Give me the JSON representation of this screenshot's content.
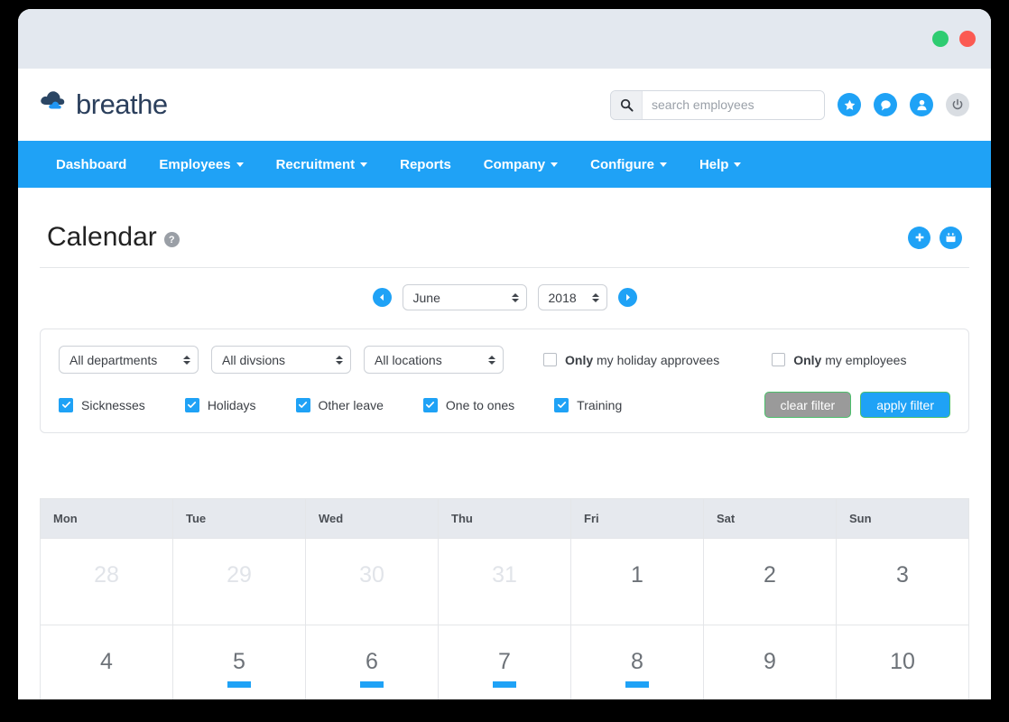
{
  "window": {
    "dots": [
      {
        "name": "minimize-dot",
        "color": "#2ecc71"
      },
      {
        "name": "close-dot",
        "color": "#fb5a52"
      }
    ]
  },
  "brand": {
    "name": "breathe",
    "logo_icon": "cloud-icon"
  },
  "search": {
    "placeholder": "search employees",
    "value": "",
    "icon": "search-icon"
  },
  "header_icons": [
    {
      "name": "star-icon",
      "glyph": "★"
    },
    {
      "name": "chat-icon",
      "glyph": "●"
    },
    {
      "name": "user-icon",
      "glyph": "●"
    },
    {
      "name": "power-icon",
      "glyph": "⏻"
    }
  ],
  "nav": {
    "items": [
      {
        "label": "Dashboard",
        "has_dropdown": false
      },
      {
        "label": "Employees",
        "has_dropdown": true
      },
      {
        "label": "Recruitment",
        "has_dropdown": true
      },
      {
        "label": "Reports",
        "has_dropdown": false
      },
      {
        "label": "Company",
        "has_dropdown": true
      },
      {
        "label": "Configure",
        "has_dropdown": true
      },
      {
        "label": "Help",
        "has_dropdown": true
      }
    ]
  },
  "page": {
    "title": "Calendar",
    "help_glyph": "?",
    "actions": [
      {
        "name": "add-button",
        "icon": "plus-icon"
      },
      {
        "name": "calendar-view-button",
        "icon": "calendar-icon"
      }
    ]
  },
  "month_nav": {
    "prev_label": "previous month",
    "next_label": "next month",
    "month": "June",
    "year": "2018"
  },
  "filters": {
    "departments": "All departments",
    "divisions": "All divsions",
    "locations": "All locations",
    "only_checks": [
      {
        "strong": "Only",
        "rest": " my holiday approvees",
        "checked": false
      },
      {
        "strong": "Only",
        "rest": " my employees",
        "checked": false
      }
    ],
    "type_checks": [
      {
        "label": "Sicknesses",
        "checked": true
      },
      {
        "label": "Holidays",
        "checked": true
      },
      {
        "label": "Other leave",
        "checked": true
      },
      {
        "label": "One to ones",
        "checked": true
      },
      {
        "label": "Training",
        "checked": true
      }
    ],
    "clear_label": "clear filter",
    "apply_label": "apply filter",
    "colors": {
      "accent": "#1fa2f6",
      "clear_bg": "#9a9a9a",
      "button_border": "#4bbf6b"
    }
  },
  "calendar": {
    "weekdays": [
      "Mon",
      "Tue",
      "Wed",
      "Thu",
      "Fri",
      "Sat",
      "Sun"
    ],
    "weeks": [
      [
        {
          "day": "28",
          "other_month": true,
          "events": 0
        },
        {
          "day": "29",
          "other_month": true,
          "events": 0
        },
        {
          "day": "30",
          "other_month": true,
          "events": 0
        },
        {
          "day": "31",
          "other_month": true,
          "events": 0
        },
        {
          "day": "1",
          "other_month": false,
          "events": 0
        },
        {
          "day": "2",
          "other_month": false,
          "events": 0
        },
        {
          "day": "3",
          "other_month": false,
          "events": 0
        }
      ],
      [
        {
          "day": "4",
          "other_month": false,
          "events": 0
        },
        {
          "day": "5",
          "other_month": false,
          "events": 1
        },
        {
          "day": "6",
          "other_month": false,
          "events": 1
        },
        {
          "day": "7",
          "other_month": false,
          "events": 1
        },
        {
          "day": "8",
          "other_month": false,
          "events": 1
        },
        {
          "day": "9",
          "other_month": false,
          "events": 0
        },
        {
          "day": "10",
          "other_month": false,
          "events": 0
        }
      ]
    ],
    "event_color": "#1fa2f6"
  }
}
